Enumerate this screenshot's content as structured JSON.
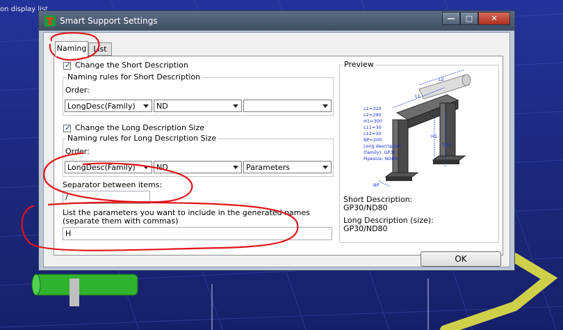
{
  "background": {
    "caption": "on display list"
  },
  "window": {
    "title": "Smart Support Settings",
    "buttons": {
      "minimize": "—",
      "maximize": "□",
      "close": "✕"
    }
  },
  "tabs": [
    {
      "label": "Naming",
      "active": true
    },
    {
      "label": "List",
      "active": false
    }
  ],
  "naming": {
    "change_short": {
      "label": "Change the Short Description",
      "checked": true
    },
    "short_group": {
      "legend": "Naming rules for Short Description",
      "order_label": "Order:",
      "combos": [
        "LongDesc(Family)",
        "ND",
        ""
      ]
    },
    "change_long": {
      "label": "Change the Long Description Size",
      "checked": true
    },
    "long_group": {
      "legend": "Naming rules for Long Description Size",
      "order_label": "Order:",
      "combos": [
        "LongDesc(Family)",
        "ND",
        "Parameters"
      ]
    },
    "separator": {
      "label": "Separator between items:",
      "value": "/"
    },
    "params": {
      "label1": "List the parameters you want to include in the generated names",
      "label2": "(separate them with commas)",
      "value": "H"
    }
  },
  "preview": {
    "legend": "Preview",
    "dims": [
      "L1=320",
      "L2=290",
      "H1=300",
      "L11=30",
      "L12=30",
      "BP=200",
      "Long description",
      "(family): GP30",
      "Pipesize: ND80"
    ],
    "dim_labels": {
      "l1": "L1",
      "l2": "L2",
      "h1": "H1",
      "th2": "TH2",
      "bp": "BP"
    },
    "short_label": "Short Description:",
    "short_value": "GP30/ND80",
    "long_label": "Long Description (size):",
    "long_value": "GP30/ND80"
  },
  "ok_label": "OK",
  "colors": {
    "annotation": "#e0141b",
    "accent_blue": "#1a3f7a",
    "dim_blue": "#1c2fd8"
  }
}
